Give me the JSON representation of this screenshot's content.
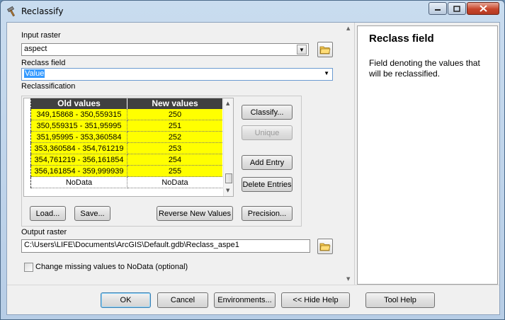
{
  "window": {
    "title": "Reclassify"
  },
  "input_raster": {
    "label": "Input raster",
    "value": "aspect"
  },
  "reclass_field": {
    "label": "Reclass field",
    "value": "Value"
  },
  "reclassification": {
    "label": "Reclassification",
    "columns": [
      "Old values",
      "New values"
    ],
    "rows": [
      {
        "old": "349,15868 - 350,559315",
        "new": "250"
      },
      {
        "old": "350,559315 - 351,95995",
        "new": "251"
      },
      {
        "old": "351,95995 - 353,360584",
        "new": "252"
      },
      {
        "old": "353,360584 - 354,761219",
        "new": "253"
      },
      {
        "old": "354,761219 - 356,161854",
        "new": "254"
      },
      {
        "old": "356,161854 - 359,999939",
        "new": "255"
      },
      {
        "old": "NoData",
        "new": "NoData"
      }
    ],
    "buttons": {
      "classify": "Classify...",
      "unique": "Unique",
      "add_entry": "Add Entry",
      "delete_entries": "Delete Entries",
      "load": "Load...",
      "save": "Save...",
      "reverse": "Reverse New Values",
      "precision": "Precision..."
    }
  },
  "output_raster": {
    "label": "Output raster",
    "value": "C:\\Users\\LIFE\\Documents\\ArcGIS\\Default.gdb\\Reclass_aspe1"
  },
  "missing_values": {
    "label": "Change missing values to NoData (optional)",
    "checked": false
  },
  "help": {
    "title": "Reclass field",
    "body": "Field denoting the values that will be reclassified."
  },
  "footer": {
    "ok": "OK",
    "cancel": "Cancel",
    "environments": "Environments...",
    "hide_help": "<< Hide Help",
    "tool_help": "Tool Help"
  },
  "colors": {
    "highlight": "#ffff00",
    "header": "#404040",
    "selection": "#3399ff"
  }
}
